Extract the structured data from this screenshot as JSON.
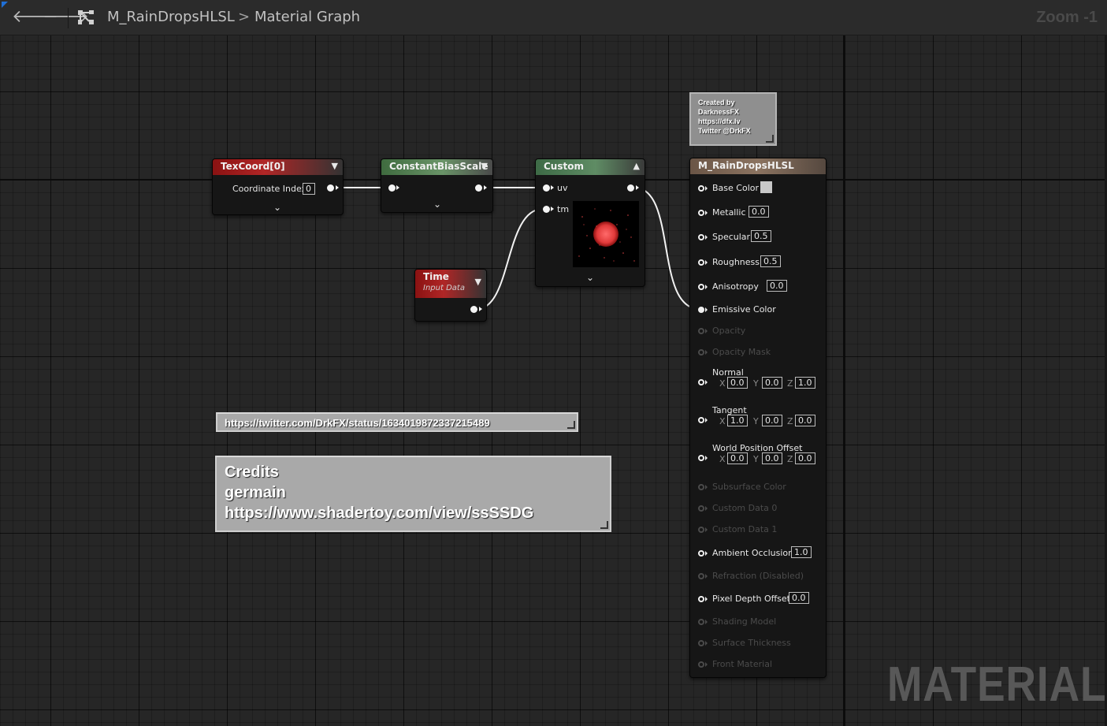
{
  "toolbar": {
    "back_icon": "back-arrow-icon",
    "forward_icon": "forward-arrow-icon",
    "graph_icon": "graph-hierarchy-icon",
    "breadcrumb_asset": "M_RainDropsHLSL",
    "breadcrumb_separator": ">",
    "breadcrumb_graph": "Material Graph",
    "zoom_label": "Zoom -1"
  },
  "nodes": {
    "texcoord": {
      "title": "TexCoord[0]",
      "input_label": "Coordinate Index",
      "input_value": "0"
    },
    "constant_bias_scale": {
      "title": "ConstantBiasScale"
    },
    "custom": {
      "title": "Custom",
      "input_uv": "uv",
      "input_tm": "tm"
    },
    "time": {
      "title": "Time",
      "subtitle": "Input Data"
    }
  },
  "comments": {
    "author": {
      "lines": [
        "Created by",
        "DarknessFX",
        "https://dfx.lv",
        "Twitter @DrkFX"
      ]
    },
    "tweet": {
      "text": "https://twitter.com/DrkFX/status/1634019872337215489"
    },
    "credits": {
      "lines": [
        "Credits",
        "germain",
        "https://www.shadertoy.com/view/ssSSDG"
      ]
    }
  },
  "material_output": {
    "title": "M_RainDropsHLSL",
    "base_color": {
      "label": "Base Color",
      "swatch": "#c8c8c8"
    },
    "metallic": {
      "label": "Metallic",
      "value": "0.0"
    },
    "specular": {
      "label": "Specular",
      "value": "0.5"
    },
    "roughness": {
      "label": "Roughness",
      "value": "0.5"
    },
    "anisotropy": {
      "label": "Anisotropy",
      "value": "0.0"
    },
    "emissive": {
      "label": "Emissive Color"
    },
    "opacity": {
      "label": "Opacity"
    },
    "opacity_mask": {
      "label": "Opacity Mask"
    },
    "normal": {
      "label": "Normal",
      "x": "0.0",
      "y": "0.0",
      "z": "1.0"
    },
    "tangent": {
      "label": "Tangent",
      "x": "1.0",
      "y": "0.0",
      "z": "0.0"
    },
    "wpo": {
      "label": "World Position Offset",
      "x": "0.0",
      "y": "0.0",
      "z": "0.0"
    },
    "subsurface": {
      "label": "Subsurface Color"
    },
    "custom0": {
      "label": "Custom Data 0"
    },
    "custom1": {
      "label": "Custom Data 1"
    },
    "ao": {
      "label": "Ambient Occlusion",
      "value": "1.0"
    },
    "refraction": {
      "label": "Refraction (Disabled)"
    },
    "pdo": {
      "label": "Pixel Depth Offset",
      "value": "0.0"
    },
    "shading_model": {
      "label": "Shading Model"
    },
    "surface_thickness": {
      "label": "Surface Thickness"
    },
    "front_material": {
      "label": "Front Material"
    },
    "axis_x": "X",
    "axis_y": "Y",
    "axis_z": "Z"
  },
  "watermark": "MATERIAL",
  "colors": {
    "graph_bg": "#262626",
    "node_red": "#b02626",
    "node_green": "#6a9468",
    "preview_red": "#e94a4a"
  }
}
